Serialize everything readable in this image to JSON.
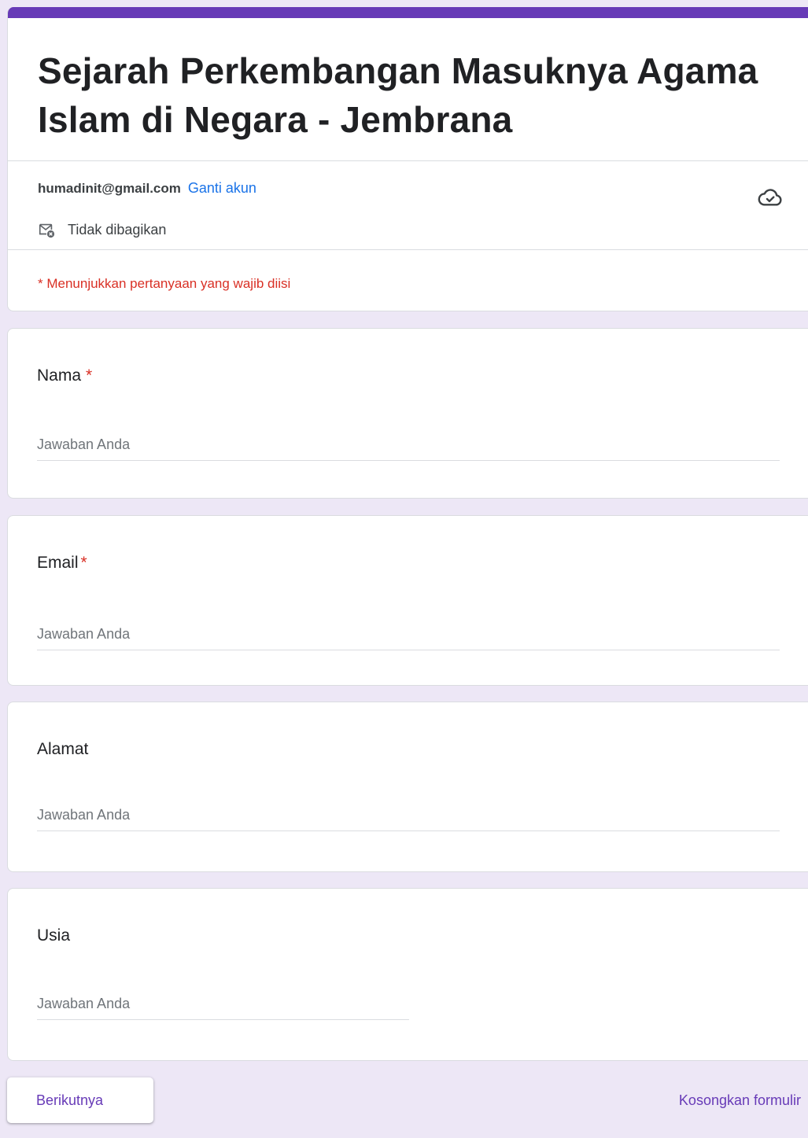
{
  "form": {
    "title": "Sejarah Perkembangan Masuknya Agama Islam di Negara - Jembrana",
    "accent_color": "#673ab7",
    "background_color": "#ede7f6"
  },
  "account": {
    "email": "humadinit@gmail.com",
    "switch_label": "Ganti akun",
    "not_shared_label": "Tidak dibagikan",
    "not_shared_icon": "mail-not-shared-icon",
    "cloud_icon": "cloud-check-icon"
  },
  "required_note": "* Menunjukkan pertanyaan yang wajib diisi",
  "questions": [
    {
      "label": "Nama",
      "required": "*",
      "placeholder": "Jawaban Anda"
    },
    {
      "label": "Email",
      "required": "*",
      "placeholder": "Jawaban Anda"
    },
    {
      "label": "Alamat",
      "required": "",
      "placeholder": "Jawaban Anda"
    },
    {
      "label": "Usia",
      "required": "",
      "placeholder": "Jawaban Anda"
    }
  ],
  "actions": {
    "next_label": "Berikutnya",
    "clear_label": "Kosongkan formulir"
  }
}
